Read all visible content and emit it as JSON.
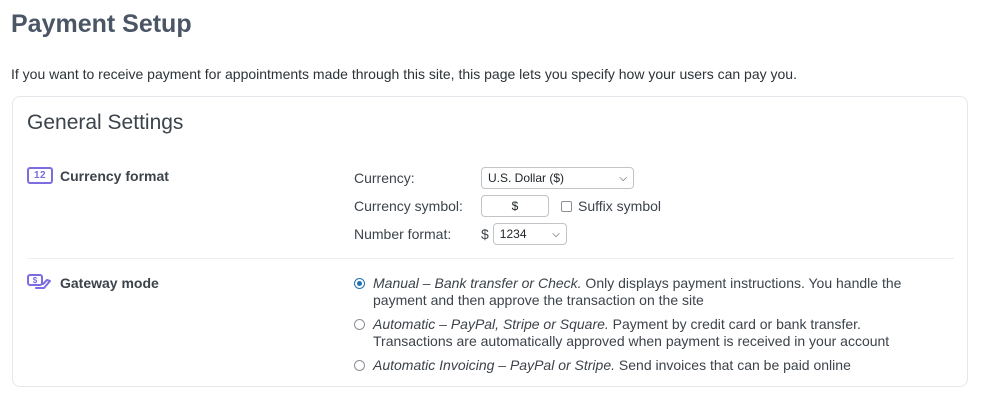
{
  "page": {
    "title": "Payment Setup",
    "intro": "If you want to receive payment for appointments made through this site, this page lets you specify how your users can pay you."
  },
  "general": {
    "title": "General Settings",
    "currency_section": {
      "label": "Currency format",
      "icon": "number-12-icon",
      "icon_text": "12",
      "currency_label": "Currency:",
      "currency_value": "U.S. Dollar ($)",
      "symbol_label": "Currency symbol:",
      "symbol_value": "$",
      "suffix_label": "Suffix symbol",
      "suffix_checked": false,
      "number_label": "Number format:",
      "number_prefix": "$",
      "number_value": "1234"
    },
    "gateway_section": {
      "label": "Gateway mode",
      "icon": "money-hand-icon",
      "options": [
        {
          "title": "Manual – Bank transfer or Check.",
          "desc": " Only displays payment instructions. You handle the payment and then approve the transaction on the site",
          "checked": true
        },
        {
          "title": "Automatic – PayPal, Stripe or Square.",
          "desc": " Payment by credit card or bank transfer. Transactions are automatically approved when payment is received in your account",
          "checked": false
        },
        {
          "title": "Automatic Invoicing – PayPal or Stripe.",
          "desc": " Send invoices that can be paid online",
          "checked": false
        }
      ]
    }
  },
  "colors": {
    "accent": "#7b6ce0",
    "radio_selected": "#2271b1"
  }
}
